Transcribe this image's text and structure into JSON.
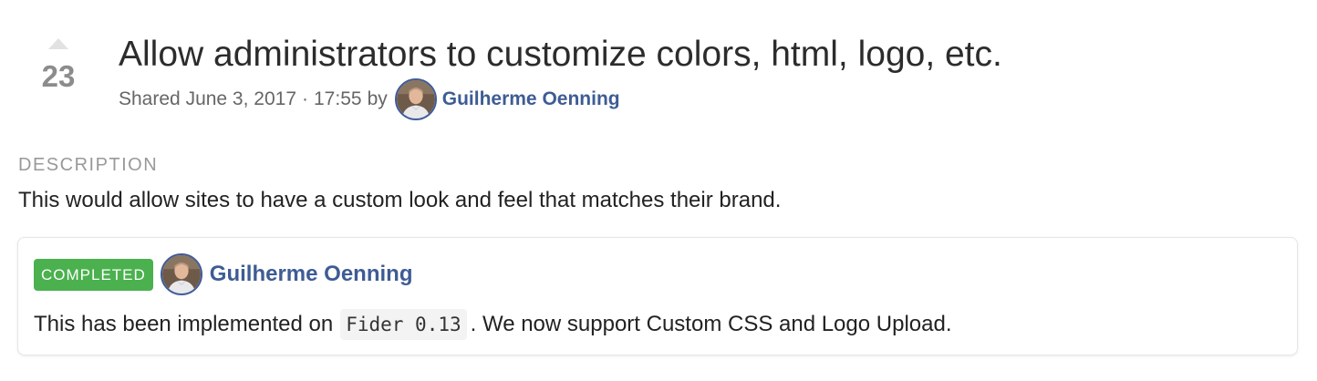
{
  "idea": {
    "vote_count": "23",
    "title": "Allow administrators to customize colors, html, logo, etc.",
    "shared_prefix": "Shared",
    "shared_date": "June 3, 2017",
    "shared_separator": "·",
    "shared_time": "17:55",
    "shared_by": "by",
    "author_name": "Guilherme Oenning"
  },
  "description": {
    "label": "Description",
    "text": "This would allow sites to have a custom look and feel that matches their brand."
  },
  "response": {
    "status": "Completed",
    "status_color": "#4ab14e",
    "author_name": "Guilherme Oenning",
    "text_before": "This has been implemented on",
    "code": "Fider 0.13",
    "text_after": ". We now support Custom CSS and Logo Upload."
  },
  "colors": {
    "author_link": "#3e5c94",
    "avatar_border": "#3f5c9a"
  },
  "icons": {
    "vote": "caret-up-icon",
    "avatar": "user-avatar"
  }
}
